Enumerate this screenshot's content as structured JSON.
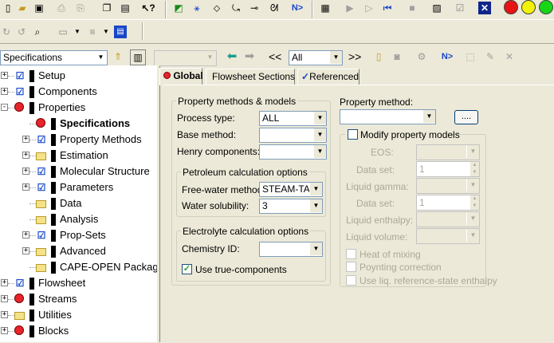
{
  "toolbar1": {
    "icons": [
      "open-icon",
      "save-icon",
      "print-icon",
      "print-preview-icon",
      "copy-icon",
      "paste-icon",
      "whats-this-icon",
      "data-browser-icon",
      "flowsheet-icon",
      "cut-stream-icon",
      "insert-icon",
      "stream-icon",
      "next-icon",
      "control-panel-icon",
      "run-icon",
      "step-icon",
      "start-icon",
      "stop-icon",
      "report-icon",
      "check-icon",
      "exit-icon"
    ],
    "status_colors": {
      "red": "#e81313",
      "yellow": "#f2f20a",
      "green": "#16d616"
    }
  },
  "navbar": {
    "form_select": "Specifications",
    "filter_select": "All",
    "prev_label": "<<",
    "next_label": ">>"
  },
  "tree": {
    "items": [
      {
        "label": "Setup",
        "level": 0,
        "icon": "check",
        "expander": "+"
      },
      {
        "label": "Components",
        "level": 0,
        "icon": "check",
        "expander": "+"
      },
      {
        "label": "Properties",
        "level": 0,
        "icon": "flask",
        "expander": "-"
      },
      {
        "label": "Specifications",
        "level": 1,
        "icon": "flask",
        "expander": "",
        "selected": true
      },
      {
        "label": "Property Methods",
        "level": 1,
        "icon": "check",
        "expander": "+"
      },
      {
        "label": "Estimation",
        "level": 1,
        "icon": "folder",
        "expander": "+"
      },
      {
        "label": "Molecular Structure",
        "level": 1,
        "icon": "check",
        "expander": "+"
      },
      {
        "label": "Parameters",
        "level": 1,
        "icon": "check",
        "expander": "+"
      },
      {
        "label": "Data",
        "level": 1,
        "icon": "folder",
        "expander": ""
      },
      {
        "label": "Analysis",
        "level": 1,
        "icon": "folder",
        "expander": ""
      },
      {
        "label": "Prop-Sets",
        "level": 1,
        "icon": "check",
        "expander": "+"
      },
      {
        "label": "Advanced",
        "level": 1,
        "icon": "folder",
        "expander": "+"
      },
      {
        "label": "CAPE-OPEN Package",
        "level": 1,
        "icon": "folder",
        "expander": ""
      },
      {
        "label": "Flowsheet",
        "level": 0,
        "icon": "check",
        "expander": "+"
      },
      {
        "label": "Streams",
        "level": 0,
        "icon": "flask",
        "expander": "+"
      },
      {
        "label": "Utilities",
        "level": 0,
        "icon": "folder",
        "expander": "+"
      },
      {
        "label": "Blocks",
        "level": 0,
        "icon": "flask",
        "expander": "+"
      }
    ]
  },
  "tabs": [
    {
      "label": "Global",
      "active": true,
      "icon": "flask"
    },
    {
      "label": "Flowsheet Sections",
      "active": false,
      "icon": ""
    },
    {
      "label": "Referenced",
      "active": false,
      "icon": "check"
    }
  ],
  "global": {
    "group_title": "Property methods & models",
    "process_type_label": "Process type:",
    "process_type_value": "ALL",
    "base_method_label": "Base method:",
    "base_method_value": "",
    "henry_label": "Henry components:",
    "henry_value": "",
    "petroleum_title": "Petroleum calculation options",
    "free_water_label": "Free-water method:",
    "free_water_value": "STEAM-TA",
    "water_sol_label": "Water solubility:",
    "water_sol_value": "3",
    "electrolyte_title": "Electrolyte calculation options",
    "chem_id_label": "Chemistry ID:",
    "chem_id_value": "",
    "true_comp_label": "Use true-components",
    "true_comp_checked": true,
    "property_method_label": "Property method:",
    "property_method_value": "",
    "ellipsis_button": "....",
    "modify_label": "Modify property models",
    "eos_label": "EOS:",
    "dataset1_label": "Data set:",
    "dataset1_value": "1",
    "liq_gamma_label": "Liquid gamma:",
    "dataset2_label": "Data set:",
    "dataset2_value": "1",
    "liq_enthalpy_label": "Liquid enthalpy:",
    "liq_volume_label": "Liquid volume:",
    "heat_mixing_label": "Heat of mixing",
    "poynting_label": "Poynting correction",
    "use_liq_ref_label": "Use liq. reference-state enthalpy"
  }
}
